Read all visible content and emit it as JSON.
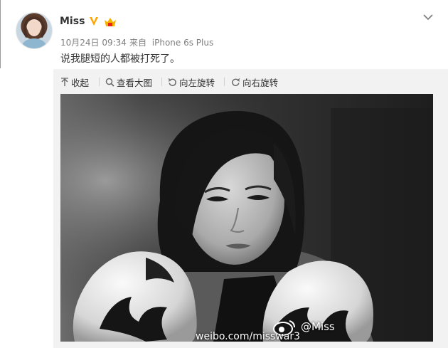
{
  "post": {
    "author": "Miss",
    "time": "10月24日 09:34",
    "source_prefix": "来自",
    "source": "iPhone 6s Plus",
    "text": "说我腿短的人都被打死了。"
  },
  "toolbar": {
    "collapse": "收起",
    "view_large": "查看大图",
    "rotate_left": "向左旋转",
    "rotate_right": "向右旋转"
  },
  "photo": {
    "watermark_name": "@Miss",
    "watermark_url": "weibo.com/misswar3"
  },
  "icons": {
    "verified": "verified-v-icon",
    "vip": "vip-crown-icon",
    "menu": "chevron-down-icon",
    "collapse": "arrow-up-icon",
    "view_large": "magnifier-icon",
    "rotate_left": "rotate-left-icon",
    "rotate_right": "rotate-right-icon",
    "watermark": "weibo-eye-logo"
  },
  "colors": {
    "verified": "#ffa500",
    "vip": "#e8231a",
    "meta_text": "#808080",
    "media_bg": "#f2f2f2"
  }
}
